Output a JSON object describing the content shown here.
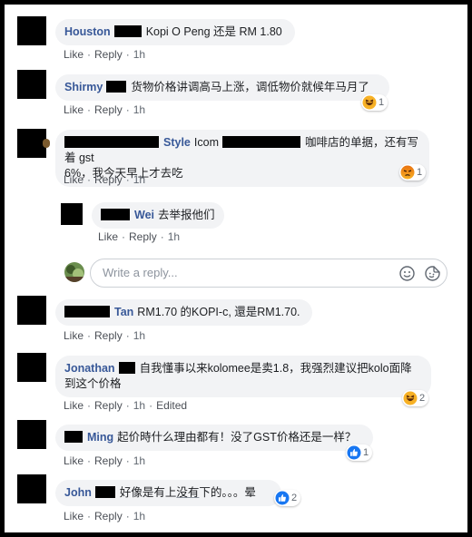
{
  "actions": {
    "like": "Like",
    "reply": "Reply",
    "separator": "·",
    "edited": "Edited"
  },
  "comments": [
    {
      "name": "Houston",
      "text": "Kopi O Peng 还是 RM 1.80",
      "time": "1h"
    },
    {
      "name": "Shirmy",
      "text": "货物价格讲调高马上涨，调低物价就候年马月了",
      "time": "1h",
      "reaction": {
        "type": "haha",
        "count": "1"
      }
    },
    {
      "name": "Style",
      "name_mid": "Icom",
      "text_l1": "咖啡店的单据，还有写着 gst",
      "text_l2": "6%，我今天早上才去吃",
      "time": "1h",
      "reaction": {
        "type": "angry",
        "count": "1"
      }
    },
    {
      "name": "Wei",
      "text": "去举报他们",
      "time": "1h"
    },
    {
      "name": "Tan",
      "text": "RM1.70 的KOPI-c, 還是RM1.70.",
      "time": "1h"
    },
    {
      "name": "Jonathan",
      "text_l1": "自我懂事以来kolomee是卖1.8，我强烈建议把kolo面降",
      "text_l2": "到这个价格",
      "time": "1h",
      "reaction": {
        "type": "haha",
        "count": "2"
      }
    },
    {
      "name": "Ming",
      "text": "起价時什么理由都有！没了GST价格还是一样？",
      "time": "1h",
      "reaction": {
        "type": "like",
        "count": "1"
      }
    },
    {
      "name": "John",
      "text_a": "好像是有上",
      "text_u": "没有",
      "text_b": "下的。。。晕",
      "time": "1h",
      "reaction": {
        "type": "like",
        "count": "2"
      }
    }
  ],
  "reply_input": {
    "placeholder": "Write a reply..."
  },
  "icons": {
    "emoji": "smiley-icon",
    "sticker": "sticker-icon"
  },
  "colors": {
    "name": "#385898",
    "bubble": "#f2f3f5",
    "like_blue": "#1877f2",
    "haha_yellow": "#f7b125",
    "angry_red": "#e9710f"
  }
}
